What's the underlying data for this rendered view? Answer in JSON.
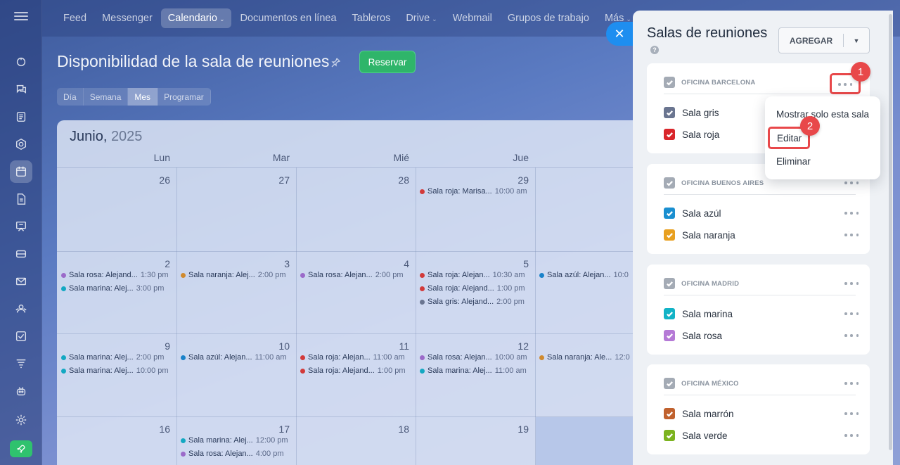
{
  "nav": {
    "items": [
      {
        "label": "Feed"
      },
      {
        "label": "Messenger"
      },
      {
        "label": "Calendario",
        "caret": "⌄",
        "active": true
      },
      {
        "label": "Documentos en línea"
      },
      {
        "label": "Tableros"
      },
      {
        "label": "Drive",
        "caret": "⌄"
      },
      {
        "label": "Webmail"
      },
      {
        "label": "Grupos de trabajo"
      },
      {
        "label": "Más",
        "caret": "⌄"
      }
    ]
  },
  "header": {
    "title": "Disponibilidad de la sala de reuniones",
    "reserve_label": "Reservar",
    "views": [
      "Día",
      "Semana",
      "Mes",
      "Programar"
    ],
    "active_view": "Mes"
  },
  "calendar": {
    "month": "Junio,",
    "year": "2025",
    "weekdays": [
      "Lun",
      "Mar",
      "Mié",
      "Jue"
    ],
    "weeks": [
      {
        "days": [
          "26",
          "27",
          "28",
          "29"
        ]
      },
      {
        "days": [
          "2",
          "3",
          "4",
          "5"
        ]
      },
      {
        "days": [
          "9",
          "10",
          "11",
          "12"
        ]
      },
      {
        "days": [
          "16",
          "17",
          "18",
          "19"
        ]
      }
    ],
    "events": [
      {
        "week": 0,
        "col": 3,
        "slot": 0,
        "title": "Sala roja: Marisa...",
        "time": "10:00 am",
        "color": "#d23a3a"
      },
      {
        "week": 1,
        "col": 0,
        "slot": 0,
        "title": "Sala rosa: Alejand...",
        "time": "1:30 pm",
        "color": "#9b6ac9"
      },
      {
        "week": 1,
        "col": 0,
        "slot": 1,
        "title": "Sala marina: Alej...",
        "time": "3:00 pm",
        "color": "#13a8c2"
      },
      {
        "week": 1,
        "col": 1,
        "slot": 0,
        "title": "Sala naranja: Alej...",
        "time": "2:00 pm",
        "color": "#d08a2e"
      },
      {
        "week": 1,
        "col": 2,
        "slot": 0,
        "title": "Sala rosa: Alejan...",
        "time": "2:00 pm",
        "color": "#9b6ac9"
      },
      {
        "week": 1,
        "col": 3,
        "slot": 0,
        "title": "Sala roja: Alejan...",
        "time": "10:30 am",
        "color": "#d23a3a"
      },
      {
        "week": 1,
        "col": 3,
        "slot": 1,
        "title": "Sala roja: Alejand...",
        "time": "1:00 pm",
        "color": "#d23a3a"
      },
      {
        "week": 1,
        "col": 3,
        "slot": 2,
        "title": "Sala gris: Alejand...",
        "time": "2:00 pm",
        "color": "#6a7590"
      },
      {
        "week": 1,
        "col": 4,
        "slot": 0,
        "title": "Sala azúl: Alejan...",
        "time": "10:0",
        "color": "#1a82c9"
      },
      {
        "week": 2,
        "col": 0,
        "slot": 0,
        "title": "Sala marina: Alej...",
        "time": "2:00 pm",
        "color": "#13a8c2"
      },
      {
        "week": 2,
        "col": 0,
        "slot": 1,
        "title": "Sala marina: Alej...",
        "time": "10:00 pm",
        "color": "#13a8c2"
      },
      {
        "week": 2,
        "col": 1,
        "slot": 0,
        "title": "Sala azúl: Alejan...",
        "time": "11:00 am",
        "color": "#1a82c9"
      },
      {
        "week": 2,
        "col": 2,
        "slot": 0,
        "title": "Sala roja: Alejan...",
        "time": "11:00 am",
        "color": "#d23a3a"
      },
      {
        "week": 2,
        "col": 2,
        "slot": 1,
        "title": "Sala roja: Alejand...",
        "time": "1:00 pm",
        "color": "#d23a3a"
      },
      {
        "week": 2,
        "col": 3,
        "slot": 0,
        "title": "Sala rosa: Alejan...",
        "time": "10:00 am",
        "color": "#9b6ac9"
      },
      {
        "week": 2,
        "col": 3,
        "slot": 1,
        "title": "Sala marina: Alej...",
        "time": "11:00 am",
        "color": "#13a8c2"
      },
      {
        "week": 2,
        "col": 4,
        "slot": 0,
        "title": "Sala naranja: Ale...",
        "time": "12:0",
        "color": "#d08a2e"
      },
      {
        "week": 3,
        "col": 1,
        "slot": 0,
        "title": "Sala marina: Alej...",
        "time": "12:00 pm",
        "color": "#13a8c2"
      },
      {
        "week": 3,
        "col": 1,
        "slot": 1,
        "title": "Sala rosa: Alejan...",
        "time": "4:00 pm",
        "color": "#9b6ac9"
      }
    ]
  },
  "panel": {
    "title": "Salas de reuniones",
    "help": "?",
    "add_label": "AGREGAR",
    "groups": [
      {
        "name": "OFICINA BARCELONA",
        "rooms": [
          {
            "name": "Sala gris",
            "color": "#6a7590"
          },
          {
            "name": "Sala roja",
            "color": "#d9262b"
          }
        ]
      },
      {
        "name": "OFICINA BUENOS AIRES",
        "rooms": [
          {
            "name": "Sala azúl",
            "color": "#1a8fd0"
          },
          {
            "name": "Sala naranja",
            "color": "#e8a020"
          }
        ]
      },
      {
        "name": "OFICINA MADRID",
        "rooms": [
          {
            "name": "Sala marina",
            "color": "#12b3c6"
          },
          {
            "name": "Sala rosa",
            "color": "#b57ad6"
          }
        ]
      },
      {
        "name": "OFICINA MÉXICO",
        "rooms": [
          {
            "name": "Sala marrón",
            "color": "#c0612e"
          },
          {
            "name": "Sala verde",
            "color": "#7cb31f"
          }
        ]
      }
    ],
    "group_check_color": "#a4abb5"
  },
  "context_menu": {
    "items": [
      "Mostrar solo esta sala",
      "Editar",
      "Eliminar"
    ]
  },
  "annotations": {
    "step1": "1",
    "step2": "2",
    "highlight_color": "#e8484a"
  }
}
